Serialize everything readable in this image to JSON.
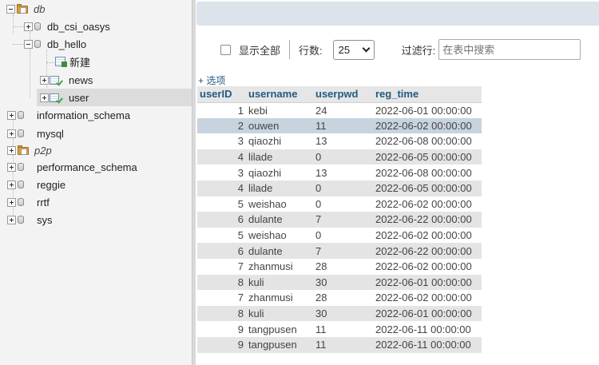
{
  "nav": {
    "items": [
      {
        "label": "db",
        "italic": true,
        "expanded": true,
        "kind": "folder-db"
      },
      {
        "label": "db_csi_oasys",
        "expanded": false,
        "kind": "db"
      },
      {
        "label": "db_hello",
        "expanded": true,
        "kind": "db"
      },
      {
        "label": "新建",
        "kind": "new"
      },
      {
        "label": "news",
        "expanded": false,
        "kind": "table"
      },
      {
        "label": "user",
        "expanded": false,
        "kind": "table",
        "selected": true
      },
      {
        "label": "information_schema",
        "expanded": false,
        "kind": "db"
      },
      {
        "label": "mysql",
        "expanded": false,
        "kind": "db"
      },
      {
        "label": "p2p",
        "italic": true,
        "expanded": false,
        "kind": "folder-db"
      },
      {
        "label": "performance_schema",
        "expanded": false,
        "kind": "db"
      },
      {
        "label": "reggie",
        "expanded": false,
        "kind": "db"
      },
      {
        "label": "rrtf",
        "expanded": false,
        "kind": "db"
      },
      {
        "label": "sys",
        "expanded": false,
        "kind": "db"
      }
    ]
  },
  "controls": {
    "show_all_label": "显示全部",
    "rows_label": "行数:",
    "rows_value": "25",
    "filter_label": "过滤行:",
    "filter_placeholder": "在表中搜索"
  },
  "options_link": "+ 选项",
  "table": {
    "columns": [
      "userID",
      "username",
      "userpwd",
      "reg_time"
    ],
    "rows": [
      [
        "1",
        "kebi",
        "24",
        "2022-06-01 00:00:00"
      ],
      [
        "2",
        "ouwen",
        "11",
        "2022-06-02 00:00:00"
      ],
      [
        "3",
        "qiaozhi",
        "13",
        "2022-06-08 00:00:00"
      ],
      [
        "4",
        "lilade",
        "0",
        "2022-06-05 00:00:00"
      ],
      [
        "3",
        "qiaozhi",
        "13",
        "2022-06-08 00:00:00"
      ],
      [
        "4",
        "lilade",
        "0",
        "2022-06-05 00:00:00"
      ],
      [
        "5",
        "weishao",
        "0",
        "2022-06-02 00:00:00"
      ],
      [
        "6",
        "dulante",
        "7",
        "2022-06-22 00:00:00"
      ],
      [
        "5",
        "weishao",
        "0",
        "2022-06-02 00:00:00"
      ],
      [
        "6",
        "dulante",
        "7",
        "2022-06-22 00:00:00"
      ],
      [
        "7",
        "zhanmusi",
        "28",
        "2022-06-02 00:00:00"
      ],
      [
        "8",
        "kuli",
        "30",
        "2022-06-01 00:00:00"
      ],
      [
        "7",
        "zhanmusi",
        "28",
        "2022-06-02 00:00:00"
      ],
      [
        "8",
        "kuli",
        "30",
        "2022-06-01 00:00:00"
      ],
      [
        "9",
        "tangpusen",
        "11",
        "2022-06-11 00:00:00"
      ],
      [
        "9",
        "tangpusen",
        "11",
        "2022-06-11 00:00:00"
      ]
    ],
    "highlighted_row": 1
  },
  "colors": {
    "link": "#235a81",
    "row_even": "#e4e4e4",
    "row_marked": "#c7d3de",
    "topbar": "#dce3ea"
  }
}
